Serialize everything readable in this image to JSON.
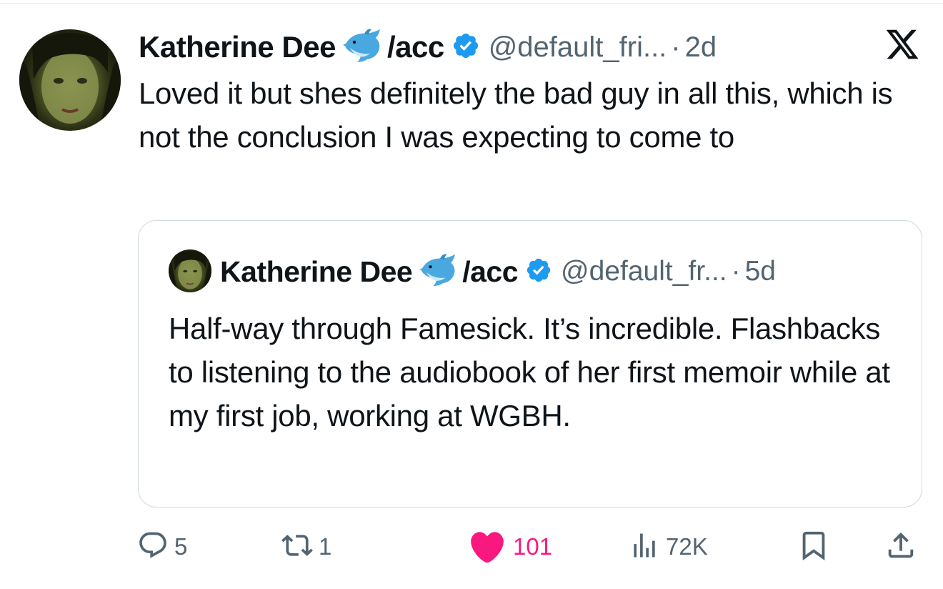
{
  "tweet": {
    "author_name": "Katherine Dee",
    "name_emoji": "dolphin-emoji",
    "name_suffix": "/acc",
    "handle": "@default_fri...",
    "dot": "·",
    "time": "2d",
    "text": "Loved it but shes definitely the bad guy in all this, which is not the conclusion I was expecting to come to"
  },
  "quoted_tweet": {
    "author_name": "Katherine Dee",
    "name_emoji": "dolphin-emoji",
    "name_suffix": "/acc",
    "handle": "@default_fr...",
    "dot": "·",
    "time": "5d",
    "text": "Half-way through Famesick. It’s incredible. Flashbacks to listening to the audiobook of her first memoir while at my first job, working at WGBH."
  },
  "actions": {
    "replies": "5",
    "retweets": "1",
    "likes": "101",
    "views": "72K"
  },
  "colors": {
    "verified_blue": "#1d9bf0",
    "like_pink": "#f91880",
    "muted_gray": "#536471",
    "border": "#cfd9de"
  },
  "icons": {
    "platform": "x-logo-icon",
    "reply": "reply-icon",
    "retweet": "retweet-icon",
    "like": "heart-icon",
    "views": "views-icon",
    "bookmark": "bookmark-icon",
    "share": "share-icon"
  }
}
